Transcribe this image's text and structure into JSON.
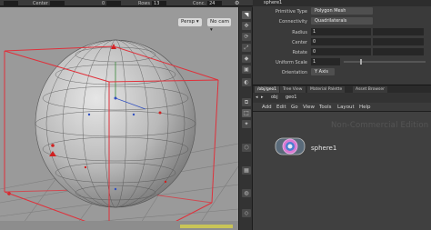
{
  "topbar": {
    "fields": [
      {
        "label": "",
        "value": ""
      },
      {
        "label": "Center",
        "value": ""
      },
      {
        "label": "0",
        "value": ""
      },
      {
        "label": "Rows",
        "value": "13"
      },
      {
        "label": "Conc.",
        "value": "24"
      }
    ]
  },
  "viewport": {
    "persp_label": "Persp ▾",
    "cam_label": "No cam ▾"
  },
  "sidebar": {
    "icons": [
      "select-icon",
      "transform-icon",
      "rotate-icon",
      "scale-icon",
      "snap-icon",
      "lock-icon",
      "display-icon",
      "view-icon",
      "camera-icon",
      "light-icon",
      "geometry-icon",
      "grid-icon"
    ]
  },
  "params": {
    "header": "sphere1",
    "rows": [
      {
        "label": "Primitive Type",
        "value": "Polygon Mesh",
        "kind": "menu"
      },
      {
        "label": "Connectivity",
        "value": "Quadrilaterals",
        "kind": "menu"
      },
      {
        "label": "Radius",
        "value": "1",
        "kind": "triple"
      },
      {
        "label": "Center",
        "value": "0",
        "kind": "triple"
      },
      {
        "label": "Rotate",
        "value": "0",
        "kind": "triple"
      },
      {
        "label": "Uniform Scale",
        "value": "1",
        "kind": "slider"
      },
      {
        "label": "Orientation",
        "value": "Y Axis",
        "kind": "menu"
      }
    ]
  },
  "network": {
    "tabs": [
      "/obj/geo1",
      "Tree View",
      "Material Palette",
      "Asset Browser"
    ],
    "path": [
      "obj",
      "geo1"
    ],
    "menu": [
      "Add",
      "Edit",
      "Go",
      "View",
      "Tools",
      "Layout",
      "Help"
    ],
    "watermark": "Non-Commercial Edition",
    "node_name": "sphere1"
  },
  "colors": {
    "viewport_bg": "#9a9a9a",
    "bbox": "#e0303a",
    "node_ring": "#d97ad0",
    "node_center": "#4a7fd0"
  }
}
